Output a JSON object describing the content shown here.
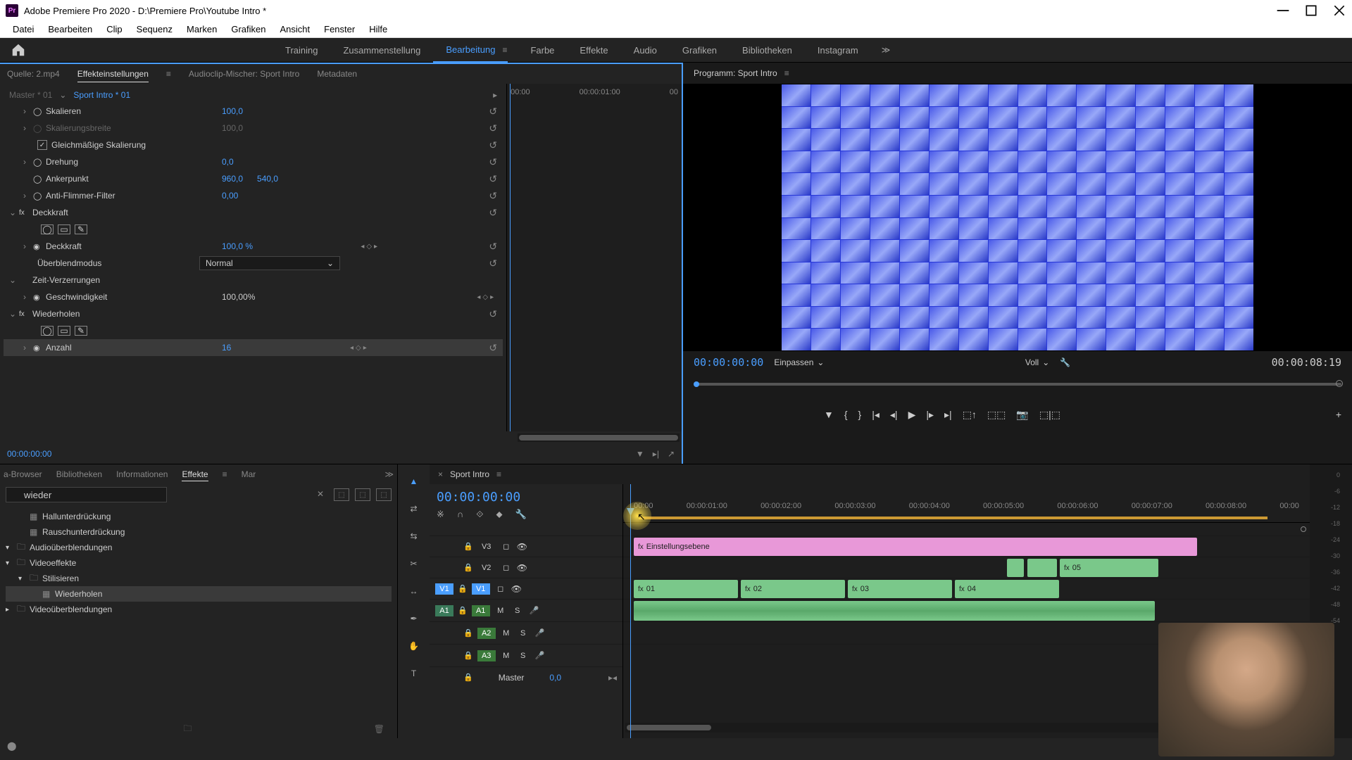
{
  "titlebar": {
    "app": "Adobe Premiere Pro 2020",
    "path": "D:\\Premiere Pro\\Youtube Intro *",
    "full": "Adobe Premiere Pro 2020 - D:\\Premiere Pro\\Youtube Intro *"
  },
  "menubar": [
    "Datei",
    "Bearbeiten",
    "Clip",
    "Sequenz",
    "Marken",
    "Grafiken",
    "Ansicht",
    "Fenster",
    "Hilfe"
  ],
  "workspaces": {
    "items": [
      "Training",
      "Zusammenstellung",
      "Bearbeitung",
      "Farbe",
      "Effekte",
      "Audio",
      "Grafiken",
      "Bibliotheken",
      "Instagram"
    ],
    "active": "Bearbeitung"
  },
  "source_tabs": {
    "items": [
      "Quelle: 2.mp4",
      "Effekteinstellungen",
      "Audioclip-Mischer: Sport Intro",
      "Metadaten"
    ],
    "active": "Effekteinstellungen"
  },
  "effect_controls": {
    "master": "Master * 01",
    "clip": "Sport Intro * 01",
    "ruler": [
      "00:00",
      "00:00:01:00",
      "00"
    ],
    "timecode": "00:00:00:00",
    "props": {
      "skalieren": {
        "name": "Skalieren",
        "val": "100,0"
      },
      "skalierungsbreite": {
        "name": "Skalierungsbreite",
        "val": "100,0"
      },
      "gleichmassig": "Gleichmäßige Skalierung",
      "drehung": {
        "name": "Drehung",
        "val": "0,0"
      },
      "ankerpunkt": {
        "name": "Ankerpunkt",
        "val1": "960,0",
        "val2": "540,0"
      },
      "antiflimmer": {
        "name": "Anti-Flimmer-Filter",
        "val": "0,00"
      },
      "deckkraft_section": "Deckkraft",
      "deckkraft": {
        "name": "Deckkraft",
        "val": "100,0 %"
      },
      "blendmodus": {
        "name": "Überblendmodus",
        "val": "Normal"
      },
      "zeitverzerrung": "Zeit-Verzerrungen",
      "geschwindigkeit": {
        "name": "Geschwindigkeit",
        "val": "100,00%"
      },
      "wiederholen": "Wiederholen",
      "anzahl": {
        "name": "Anzahl",
        "val": "16"
      }
    }
  },
  "program": {
    "title": "Programm: Sport Intro",
    "tc_left": "00:00:00:00",
    "fit": "Einpassen",
    "res": "Voll",
    "tc_right": "00:00:08:19"
  },
  "effects_panel": {
    "tabs": [
      "a-Browser",
      "Bibliotheken",
      "Informationen",
      "Effekte",
      "Mar"
    ],
    "active": "Effekte",
    "search": "wieder",
    "tree": [
      {
        "lvl": 1,
        "type": "preset",
        "label": "Hallunterdrückung"
      },
      {
        "lvl": 1,
        "type": "preset",
        "label": "Rauschunterdrückung"
      },
      {
        "lvl": 0,
        "type": "folder",
        "exp": "▾",
        "label": "Audioüberblendungen"
      },
      {
        "lvl": 0,
        "type": "folder",
        "exp": "▾",
        "label": "Videoeffekte"
      },
      {
        "lvl": 1,
        "type": "folder",
        "exp": "▾",
        "label": "Stilisieren"
      },
      {
        "lvl": 2,
        "type": "preset",
        "label": "Wiederholen",
        "selected": true
      },
      {
        "lvl": 0,
        "type": "folder",
        "exp": "▸",
        "label": "Videoüberblendungen"
      }
    ]
  },
  "timeline": {
    "name": "Sport Intro",
    "tc": "00:00:00:00",
    "ruler": [
      "00:00",
      "00:00:01:00",
      "00:00:02:00",
      "00:00:03:00",
      "00:00:04:00",
      "00:00:05:00",
      "00:00:06:00",
      "00:00:07:00",
      "00:00:08:00",
      "00:00"
    ],
    "tracks": {
      "v3": "V3",
      "v2": "V2",
      "v1": "V1",
      "v1src": "V1",
      "a1": "A1",
      "a1src": "A1",
      "a2": "A2",
      "a3": "A3",
      "master": "Master",
      "master_val": "0,0"
    },
    "clips": {
      "adjustment": "Einstellungsebene",
      "c1": "01",
      "c2": "02",
      "c3": "03",
      "c4": "04",
      "c5": "05"
    }
  },
  "meters": [
    "0",
    "-6",
    "-12",
    "-18",
    "-24",
    "-30",
    "-36",
    "-42",
    "-48",
    "-54"
  ]
}
